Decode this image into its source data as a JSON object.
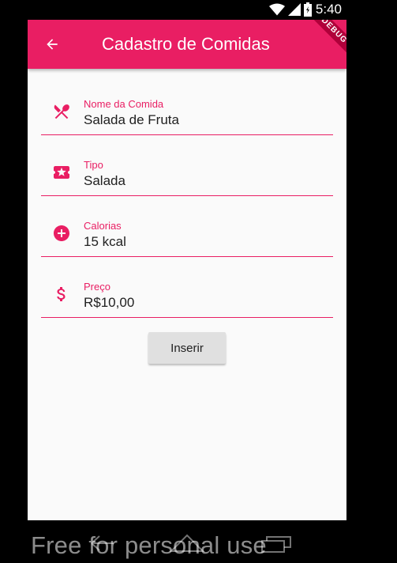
{
  "status_bar": {
    "time": "5:40",
    "icons": [
      "wifi-icon",
      "signal-icon",
      "battery-icon"
    ]
  },
  "app_bar": {
    "title": "Cadastro de Comidas",
    "back_icon": "arrow-back-icon",
    "debug_banner": "DEBUG",
    "color": "#e91e63"
  },
  "form": {
    "fields": [
      {
        "icon": "fork-knife-icon",
        "label": "Nome da Comida",
        "value": "Salada de Fruta"
      },
      {
        "icon": "ticket-icon",
        "label": "Tipo",
        "value": "Salada"
      },
      {
        "icon": "add-circle-icon",
        "label": "Calorias",
        "value": "15 kcal"
      },
      {
        "icon": "dollar-icon",
        "label": "Preço",
        "value": "R$10,00"
      }
    ],
    "submit_label": "Inserir"
  },
  "watermark": "Free for personal use",
  "accent_color": "#e91e63"
}
